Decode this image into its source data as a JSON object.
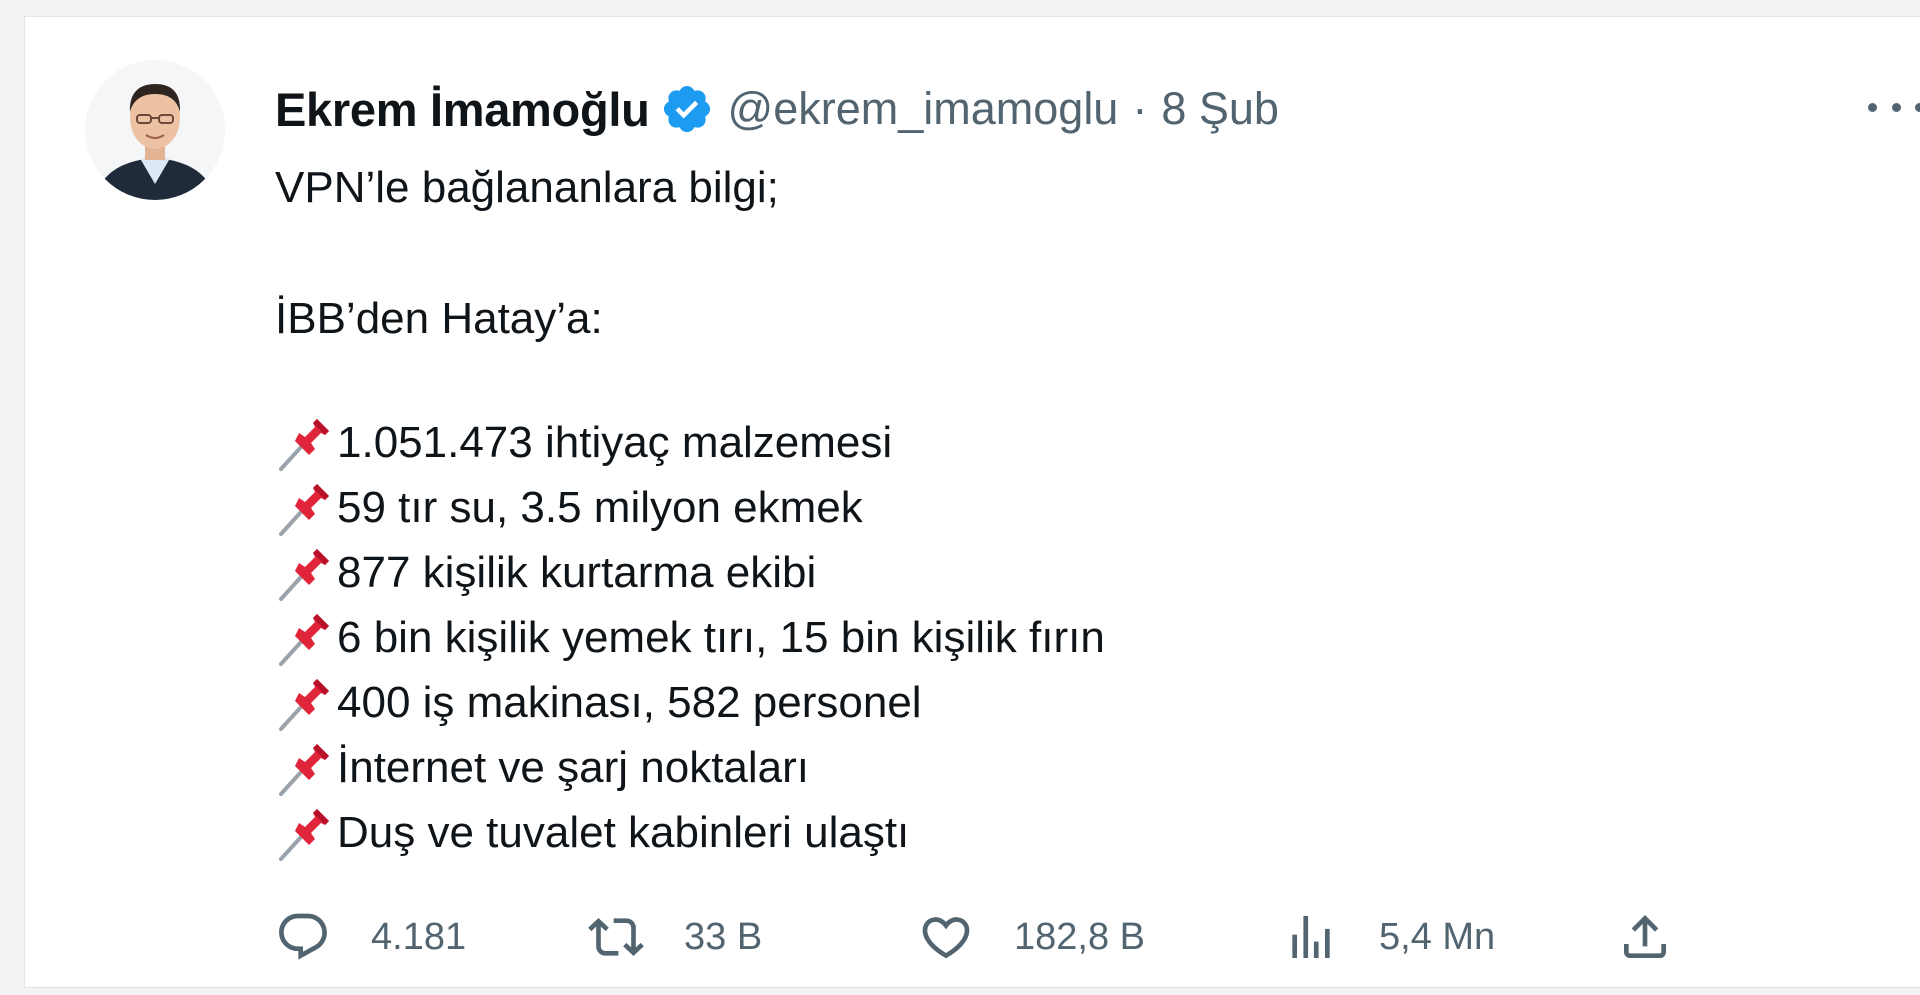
{
  "tweet": {
    "author": {
      "name": "Ekrem İmamoğlu",
      "verified_icon": "verified-badge-icon",
      "handle": "@ekrem_imamoglu",
      "separator": "·",
      "date": "8 Şub"
    },
    "more_icon": "more-options-icon",
    "text": {
      "line1": "VPN’le bağlananlara bilgi;",
      "line2": "İBB’den Hatay’a:"
    },
    "items": [
      "1.051.473 ihtiyaç malzemesi",
      "59 tır su, 3.5 milyon ekmek",
      "877 kişilik kurtarma ekibi",
      "6 bin kişilik yemek tırı, 15 bin kişilik fırın",
      "400 iş makinası, 582 personel",
      "İnternet ve şarj noktaları",
      "Duş ve tuvalet kabinleri ulaştı"
    ],
    "item_icon": "pushpin-icon",
    "actions": {
      "reply": {
        "icon": "reply-icon",
        "count": "4.181"
      },
      "retweet": {
        "icon": "retweet-icon",
        "count": "33 B"
      },
      "like": {
        "icon": "heart-icon",
        "count": "182,8 B"
      },
      "views": {
        "icon": "views-chart-icon",
        "count": "5,4 Mn"
      },
      "share": {
        "icon": "share-icon"
      }
    }
  },
  "colors": {
    "verified": "#1d9bf0",
    "secondary_text": "#536471",
    "primary_text": "#0f1419",
    "pin": "#e0243a"
  }
}
